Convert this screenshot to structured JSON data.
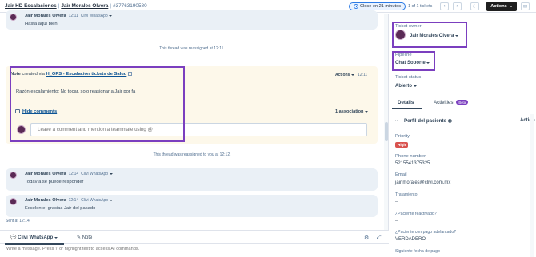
{
  "header": {
    "breadcrumb_1": "Jair HD Escalaciones",
    "breadcrumb_2": "Jair Morales Olvera",
    "separator": "|",
    "ticket_number": "#37763190580",
    "close_timer": "Close en 21 minutos",
    "pager": "1 of 1 tickets",
    "prev_icon": "chevron-left-icon",
    "next_icon": "chevron-right-icon",
    "theme_icon": "moon-icon",
    "actions_label": "Actions",
    "email_icon": "email-icon"
  },
  "thread": {
    "msg1": {
      "author": "Jair Morales Olvera",
      "time": "12:11",
      "channel": "Clivi WhatsApp",
      "text": "Hasta aquí bien"
    },
    "sys1": "This thread was reassigned at 12:11.",
    "note": {
      "prefix": "Note",
      "created_via": "created via",
      "link": "H_OPS - Escalación tickets de Salud",
      "actions": "Actions",
      "time": "12:11",
      "text": "Razón escalamiento: No tocar, solo reasignar a Jair por fa",
      "hide_comments": "Hide comments",
      "associations": "1 association",
      "comment_placeholder": "Leave a comment and mention a teammate using @"
    },
    "sys2": "This thread was reassigned to you at 12:12.",
    "msg2": {
      "author": "Jair Morales Olvera",
      "time": "12:14",
      "channel": "Clivi WhatsApp",
      "text": "Todavía se puede responder"
    },
    "msg3": {
      "author": "Jair Morales Olvera",
      "time": "12:14",
      "channel": "Clivi WhatsApp",
      "text": "Excelente, gracias Jair del pasado"
    },
    "sent_at": "Sent at 12:14"
  },
  "composer": {
    "channel_tab": "Clivi WhatsApp",
    "note_tab": "Note",
    "placeholder": "Write a message. Press '/' or highlight text to access AI commands.",
    "settings_icon": "gear-icon",
    "expand_icon": "expand-icon"
  },
  "right_panel": {
    "owner_label": "Ticket owner",
    "owner_value": "Jair Morales Olvera",
    "pipeline_label": "Pipeline",
    "pipeline_value": "Chat Soporte",
    "status_label": "Ticket status",
    "status_value": "Abierto",
    "tab_details": "Details",
    "tab_activities": "Activities",
    "beta": "Beta",
    "section_title": "Perfil del paciente",
    "section_action": "Action",
    "fields": {
      "priority_label": "Priority",
      "priority_value": "High",
      "phone_label": "Phone number",
      "phone_value": "5215541375325",
      "email_label": "Email",
      "email_value": "jair.morales@clivi.com.mx",
      "treatment_label": "Tratamiento",
      "treatment_value": "--",
      "reactivated_label": "¿Paciente reactivado?",
      "reactivated_value": "--",
      "advance_label": "¿Paciente con pago adelantado?",
      "advance_value": "VERDADERO",
      "next_payment_label": "Siguiente fecha de pago"
    }
  }
}
